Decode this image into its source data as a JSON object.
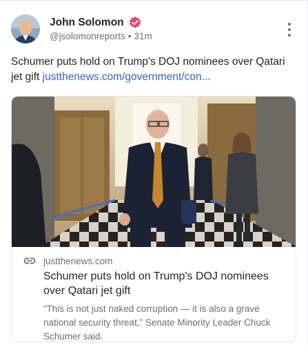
{
  "post": {
    "author": {
      "display_name": "John Solomon",
      "handle": "@jsolomonreports",
      "separator": "•",
      "time_ago": "31m",
      "verified_icon": "verified-badge-icon",
      "verified_color": "#e8456b"
    },
    "text_main": "Schumer puts hold on Trump's DOJ nominees over Qatari jet gift ",
    "text_link": "justthenews.com/government/con...",
    "link_color": "#3463c9",
    "more_icon": "more-vertical-icon"
  },
  "link_card": {
    "domain_icon": "link-icon",
    "domain": "justthenews.com",
    "title": "Schumer puts hold on Trump's DOJ nominees over Qatari jet gift",
    "description": "“This is not just naked corruption — it is also a grave national security threat,” Senate Minority Leader Chuck Schumer said."
  }
}
